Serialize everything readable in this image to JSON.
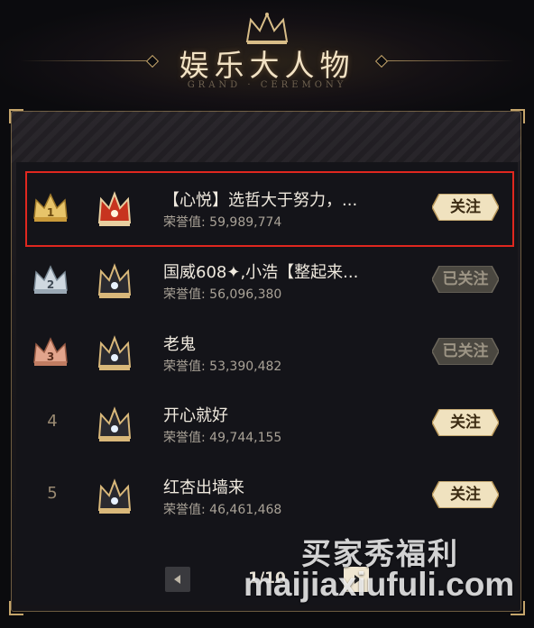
{
  "header": {
    "title": "娱乐大人物",
    "subtitle": "GRAND · CEREMONY"
  },
  "ranking": [
    {
      "rank": "1",
      "name": "【心悦】选哲大于努力，...",
      "honor_label": "荣誉值:",
      "honor_value": "59,989,774",
      "follow_label": "关注",
      "followed": false
    },
    {
      "rank": "2",
      "name": "国威608✦,小浩【整起来...",
      "honor_label": "荣誉值:",
      "honor_value": "56,096,380",
      "follow_label": "已关注",
      "followed": true
    },
    {
      "rank": "3",
      "name": "老鬼",
      "honor_label": "荣誉值:",
      "honor_value": "53,390,482",
      "follow_label": "已关注",
      "followed": true
    },
    {
      "rank": "4",
      "name": "开心就好",
      "honor_label": "荣誉值:",
      "honor_value": "49,744,155",
      "follow_label": "关注",
      "followed": false
    },
    {
      "rank": "5",
      "name": "红杏出墙来",
      "honor_label": "荣誉值:",
      "honor_value": "46,461,468",
      "follow_label": "关注",
      "followed": false
    }
  ],
  "pagination": {
    "indicator": "1/10"
  },
  "watermark": {
    "line1": "买家秀福利",
    "line2": "maijiaxiufuli.com"
  },
  "colors": {
    "gold": "#c6a66c",
    "highlight_border": "#e0271f",
    "follow_button": "#f0e2bf",
    "followed_button": "#4a4740"
  },
  "icons": {
    "rank1": "gold-crown-icon",
    "rank2": "silver-crown-icon",
    "rank3": "bronze-crown-icon",
    "badge": "crown-badge-icon"
  }
}
